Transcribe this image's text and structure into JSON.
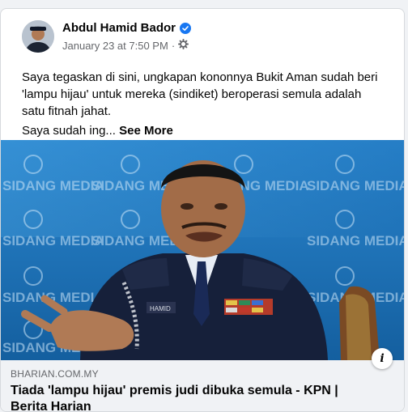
{
  "post": {
    "author": "Abdul Hamid Bador",
    "timestamp": "January 23 at 7:50 PM",
    "separator": "·",
    "text": "Saya tegaskan di sini, ungkapan kononnya Bukit Aman sudah beri 'lampu hijau' untuk mereka (sindiket) beroperasi semula adalah satu fitnah jahat.",
    "text_truncated": "Saya sudah ing...",
    "see_more": "See More"
  },
  "image": {
    "backdrop_text": "SIDANG MEDIA",
    "name_tag": "HAMID"
  },
  "link_preview": {
    "domain": "BHARIAN.COM.MY",
    "headline": "Tiada 'lampu hijau' premis judi dibuka semula - KPN | Berita Harian",
    "info_icon": "i"
  },
  "colors": {
    "verified": "#1877f2",
    "photo_background": "#1a6fb8",
    "link_bar": "#f0f2f5"
  },
  "icons": [
    "verified-badge-icon",
    "privacy-gear-icon",
    "info-icon"
  ]
}
